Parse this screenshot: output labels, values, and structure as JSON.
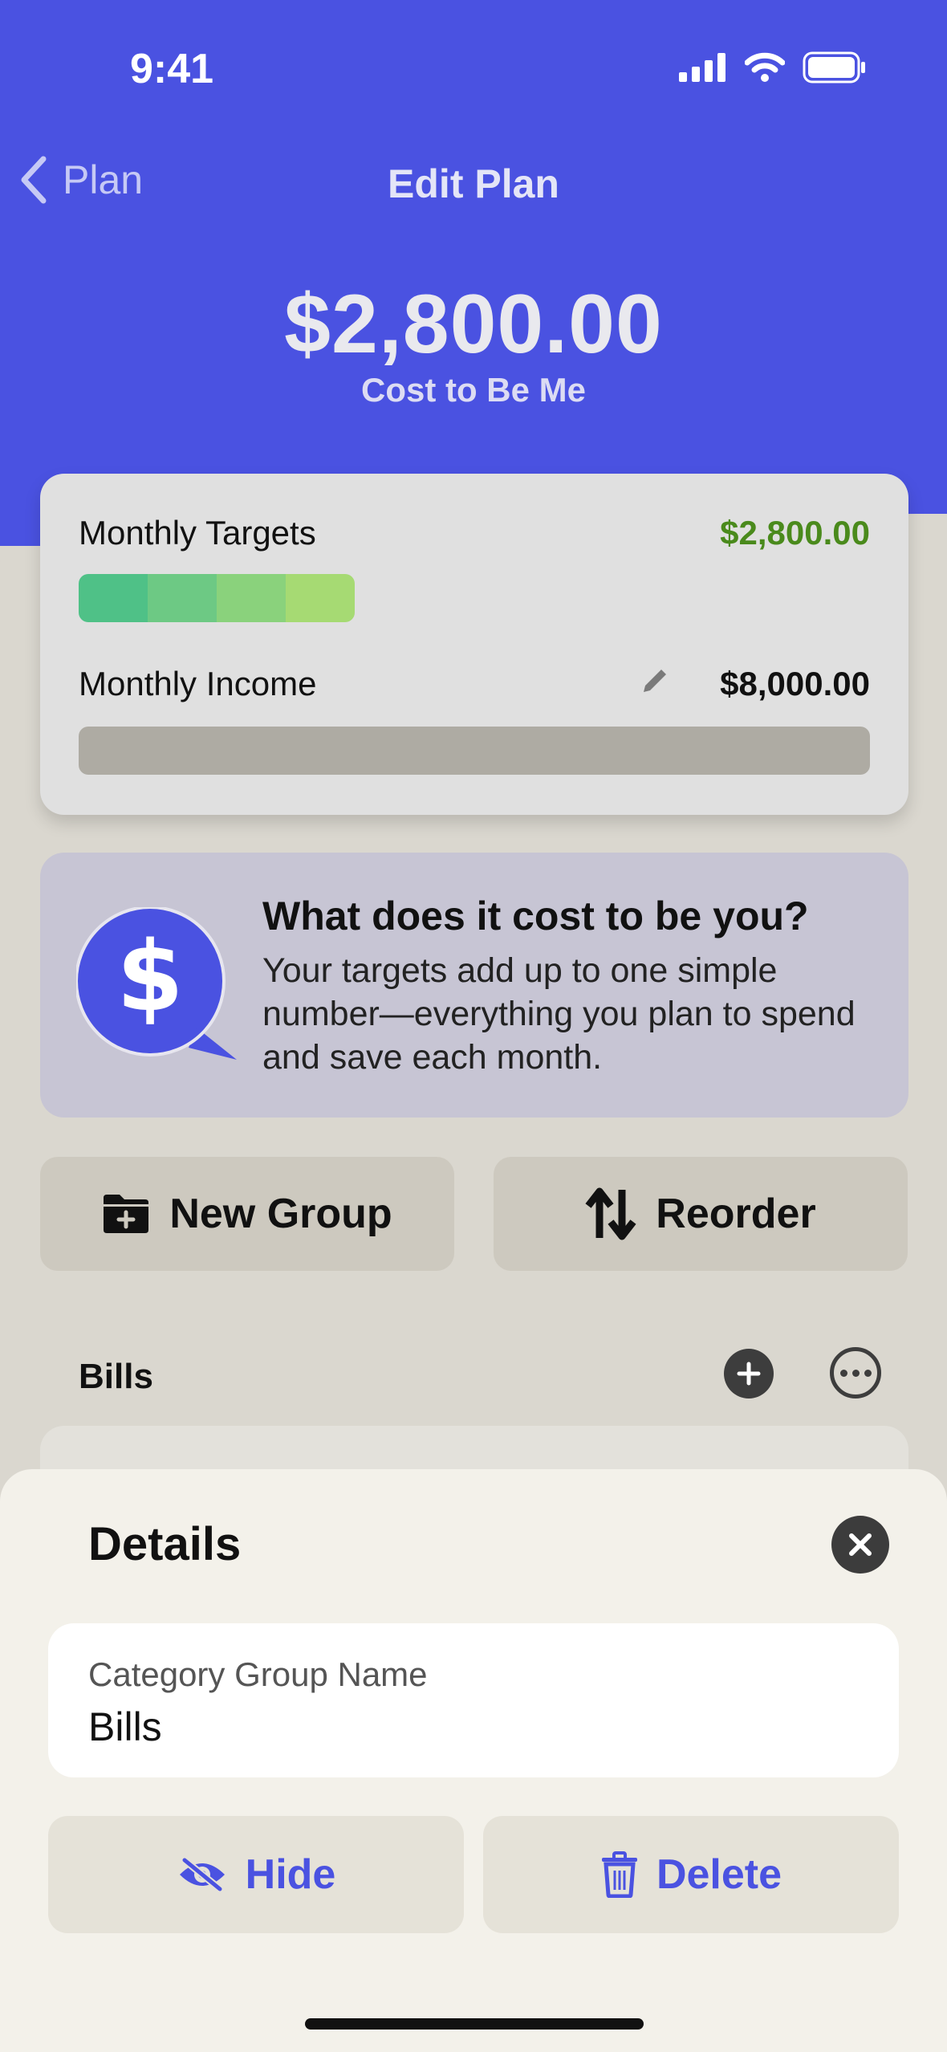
{
  "status_bar": {
    "time": "9:41"
  },
  "nav": {
    "back_label": "Plan",
    "title": "Edit Plan"
  },
  "hero": {
    "amount": "$2,800.00",
    "label": "Cost to Be Me"
  },
  "summary": {
    "targets_label": "Monthly Targets",
    "targets_amount": "$2,800.00",
    "targets_color": "#4a8a1c",
    "targets_bar_colors": [
      "#4fc187",
      "#6dc984",
      "#8ad27c",
      "#a6da73"
    ],
    "income_label": "Monthly Income",
    "income_amount": "$8,000.00"
  },
  "info": {
    "heading": "What does it cost to be you?",
    "body": "Your targets add up to one simple number—everything you plan to spend and save each month."
  },
  "actions": {
    "new_group": "New Group",
    "reorder": "Reorder"
  },
  "group": {
    "name": "Bills"
  },
  "sheet": {
    "title": "Details",
    "field_label": "Category Group Name",
    "field_value": "Bills",
    "hide": "Hide",
    "delete": "Delete"
  },
  "colors": {
    "accent": "#4a52e1"
  }
}
